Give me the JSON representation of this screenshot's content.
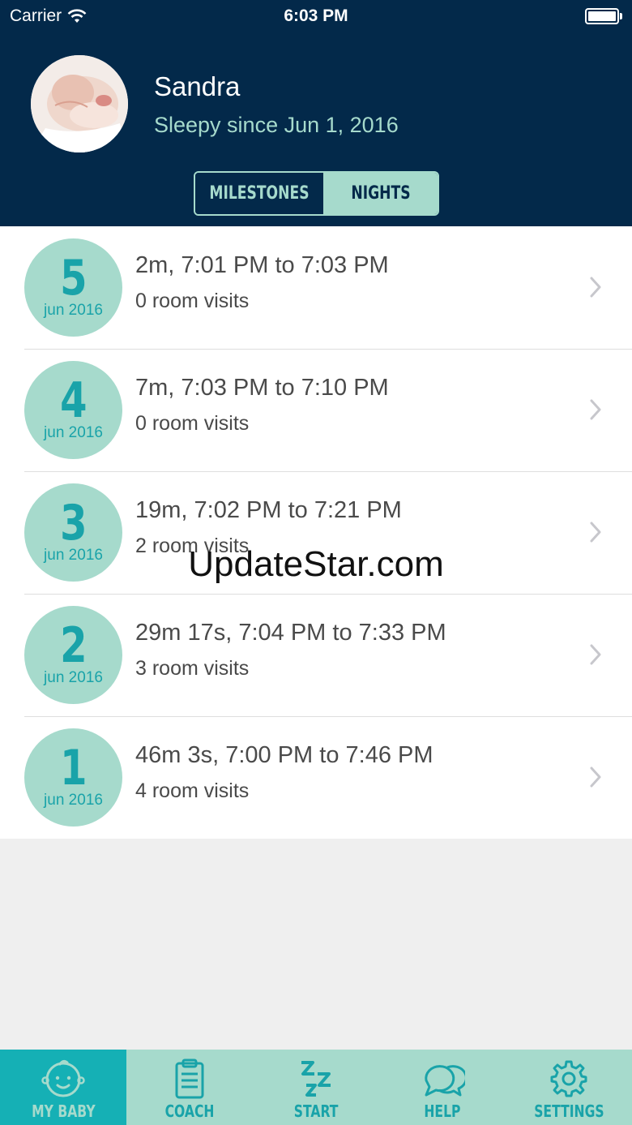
{
  "status_bar": {
    "carrier": "Carrier",
    "time": "6:03 PM"
  },
  "profile": {
    "name": "Sandra",
    "subtitle": "Sleepy since Jun 1, 2016"
  },
  "segments": [
    {
      "label": "MILESTONES",
      "active": false
    },
    {
      "label": "NIGHTS",
      "active": true
    }
  ],
  "nights": [
    {
      "day": "5",
      "month": "jun 2016",
      "title": "2m, 7:01 PM to 7:03 PM",
      "subtitle": "0 room visits"
    },
    {
      "day": "4",
      "month": "jun 2016",
      "title": "7m, 7:03 PM to 7:10 PM",
      "subtitle": "0 room visits"
    },
    {
      "day": "3",
      "month": "jun 2016",
      "title": "19m, 7:02 PM to 7:21 PM",
      "subtitle": "2 room visits"
    },
    {
      "day": "2",
      "month": "jun 2016",
      "title": "29m 17s, 7:04 PM to 7:33 PM",
      "subtitle": "3 room visits"
    },
    {
      "day": "1",
      "month": "jun 2016",
      "title": "46m 3s, 7:00 PM to 7:46 PM",
      "subtitle": "4 room visits"
    }
  ],
  "watermark": "UpdateStar.com",
  "tabs": [
    {
      "label": "MY BABY",
      "icon": "baby-face-icon",
      "active": true
    },
    {
      "label": "COACH",
      "icon": "clipboard-icon",
      "active": false
    },
    {
      "label": "START",
      "icon": "zzz-icon",
      "active": false
    },
    {
      "label": "HELP",
      "icon": "chat-bubbles-icon",
      "active": false
    },
    {
      "label": "SETTINGS",
      "icon": "gear-icon",
      "active": false
    }
  ],
  "colors": {
    "header_bg": "#03294a",
    "accent_mint": "#a6dacc",
    "accent_teal": "#19a3a9",
    "active_tab": "#15b0b5"
  }
}
